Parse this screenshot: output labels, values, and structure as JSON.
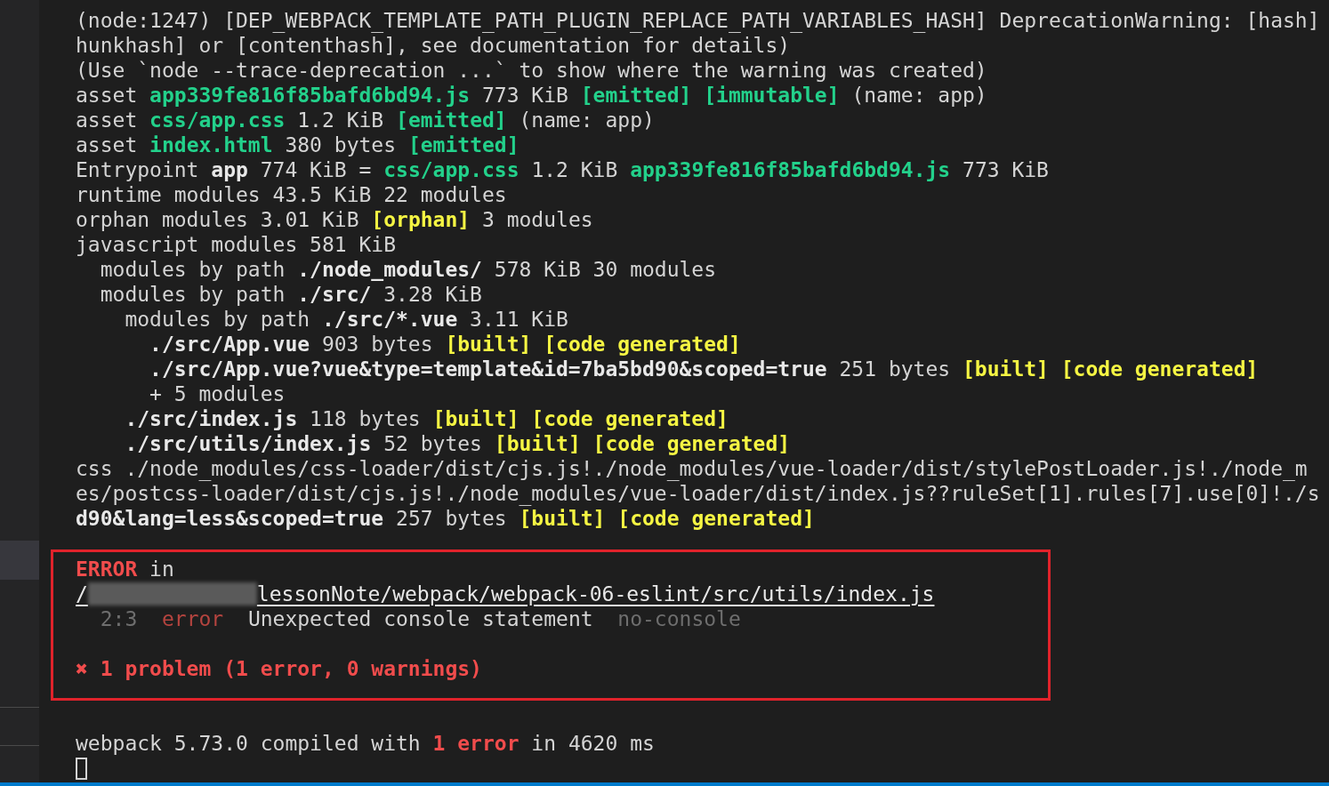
{
  "terminal": {
    "output_lines": [
      {
        "segments": [
          {
            "kind": "plain",
            "text": "(node:1247) [DEP_WEBPACK_TEMPLATE_PATH_PLUGIN_REPLACE_PATH_VARIABLES_HASH] DeprecationWarning: [hash]"
          }
        ]
      },
      {
        "segments": [
          {
            "kind": "plain",
            "text": "hunkhash] or [contenthash], see documentation for details)"
          }
        ]
      },
      {
        "segments": [
          {
            "kind": "plain",
            "text": "(Use `node --trace-deprecation ...` to show where the warning was created)"
          }
        ]
      },
      {
        "segments": [
          {
            "kind": "plain",
            "text": "asset "
          },
          {
            "kind": "green",
            "text": "app339fe816f85bafd6bd94.js"
          },
          {
            "kind": "plain",
            "text": " 773 KiB "
          },
          {
            "kind": "green",
            "text": "[emitted] [immutable]"
          },
          {
            "kind": "plain",
            "text": " (name: app)"
          }
        ]
      },
      {
        "segments": [
          {
            "kind": "plain",
            "text": "asset "
          },
          {
            "kind": "green",
            "text": "css/app.css"
          },
          {
            "kind": "plain",
            "text": " 1.2 KiB "
          },
          {
            "kind": "green",
            "text": "[emitted]"
          },
          {
            "kind": "plain",
            "text": " (name: app)"
          }
        ]
      },
      {
        "segments": [
          {
            "kind": "plain",
            "text": "asset "
          },
          {
            "kind": "green",
            "text": "index.html"
          },
          {
            "kind": "plain",
            "text": " 380 bytes "
          },
          {
            "kind": "green",
            "text": "[emitted]"
          }
        ]
      },
      {
        "segments": [
          {
            "kind": "plain",
            "text": "Entrypoint "
          },
          {
            "kind": "bold",
            "text": "app"
          },
          {
            "kind": "plain",
            "text": " 774 KiB = "
          },
          {
            "kind": "green",
            "text": "css/app.css"
          },
          {
            "kind": "plain",
            "text": " 1.2 KiB "
          },
          {
            "kind": "green",
            "text": "app339fe816f85bafd6bd94.js"
          },
          {
            "kind": "plain",
            "text": " 773 KiB"
          }
        ]
      },
      {
        "segments": [
          {
            "kind": "plain",
            "text": "runtime modules 43.5 KiB 22 modules"
          }
        ]
      },
      {
        "segments": [
          {
            "kind": "plain",
            "text": "orphan modules 3.01 KiB "
          },
          {
            "kind": "yellow",
            "text": "[orphan]"
          },
          {
            "kind": "plain",
            "text": " 3 modules"
          }
        ]
      },
      {
        "segments": [
          {
            "kind": "plain",
            "text": "javascript modules 581 KiB"
          }
        ],
        "children": [
          {
            "segments": [
              {
                "kind": "plain",
                "text": "modules by path "
              },
              {
                "kind": "bold",
                "text": "./node_modules/"
              },
              {
                "kind": "plain",
                "text": " 578 KiB 30 modules"
              }
            ]
          },
          {
            "segments": [
              {
                "kind": "plain",
                "text": "modules by path "
              },
              {
                "kind": "bold",
                "text": "./src/"
              },
              {
                "kind": "plain",
                "text": " 3.28 KiB"
              }
            ],
            "children": [
              {
                "segments": [
                  {
                    "kind": "plain",
                    "text": "modules by path "
                  },
                  {
                    "kind": "bold",
                    "text": "./src/*.vue"
                  },
                  {
                    "kind": "plain",
                    "text": " 3.11 KiB"
                  }
                ],
                "children": [
                  {
                    "segments": [
                      {
                        "kind": "bold",
                        "text": "./src/App.vue"
                      },
                      {
                        "kind": "plain",
                        "text": " 903 bytes "
                      },
                      {
                        "kind": "yellow",
                        "text": "[built] [code generated]"
                      }
                    ]
                  },
                  {
                    "segments": [
                      {
                        "kind": "bold",
                        "text": "./src/App.vue?vue&type=template&id=7ba5bd90&scoped=true"
                      },
                      {
                        "kind": "plain",
                        "text": " 251 bytes "
                      },
                      {
                        "kind": "yellow",
                        "text": "[built] [code generated]"
                      }
                    ]
                  },
                  {
                    "segments": [
                      {
                        "kind": "plain",
                        "text": "+ 5 modules"
                      }
                    ]
                  }
                ]
              },
              {
                "segments": [
                  {
                    "kind": "bold",
                    "text": "./src/index.js"
                  },
                  {
                    "kind": "plain",
                    "text": " 118 bytes "
                  },
                  {
                    "kind": "yellow",
                    "text": "[built] [code generated]"
                  }
                ]
              },
              {
                "segments": [
                  {
                    "kind": "bold",
                    "text": "./src/utils/index.js"
                  },
                  {
                    "kind": "plain",
                    "text": " 52 bytes "
                  },
                  {
                    "kind": "yellow",
                    "text": "[built] [code generated]"
                  }
                ]
              }
            ]
          }
        ]
      },
      {
        "segments": [
          {
            "kind": "plain",
            "text": "css ./node_modules/css-loader/dist/cjs.js!./node_modules/vue-loader/dist/stylePostLoader.js!./node_m"
          }
        ]
      },
      {
        "segments": [
          {
            "kind": "plain",
            "text": "es/postcss-loader/dist/cjs.js!./node_modules/vue-loader/dist/index.js??ruleSet[1].rules[7].use[0]!./s"
          }
        ]
      },
      {
        "segments": [
          {
            "kind": "bold",
            "text": "d90&lang=less&scoped=true"
          },
          {
            "kind": "plain",
            "text": " 257 bytes "
          },
          {
            "kind": "yellow",
            "text": "[built] [code generated]"
          }
        ]
      }
    ],
    "error_report": [
      {
        "kind": "text",
        "segments": [
          {
            "kind": "red",
            "text": "ERROR"
          },
          {
            "kind": "plain",
            "text": " in"
          }
        ]
      },
      {
        "kind": "path",
        "prefix": "/",
        "rest": "lessonNote/webpack/webpack-06-eslint/src/utils/index.js"
      },
      {
        "kind": "text",
        "segments": [
          {
            "kind": "dim",
            "text": "  2:3"
          },
          {
            "kind": "dimred",
            "text": "  error"
          },
          {
            "kind": "plain",
            "text": "  Unexpected console statement"
          },
          {
            "kind": "dim",
            "text": "  no-console"
          }
        ]
      },
      {
        "kind": "problem",
        "segments": [
          {
            "kind": "red",
            "text": "✖ 1 problem (1 error, 0 warnings)"
          }
        ]
      }
    ],
    "summary_lines": [
      {
        "segments": [
          {
            "kind": "plain",
            "text": "webpack 5.73.0 compiled with "
          },
          {
            "kind": "red",
            "text": "1 error"
          },
          {
            "kind": "plain",
            "text": " in 4620 ms"
          }
        ]
      }
    ]
  }
}
